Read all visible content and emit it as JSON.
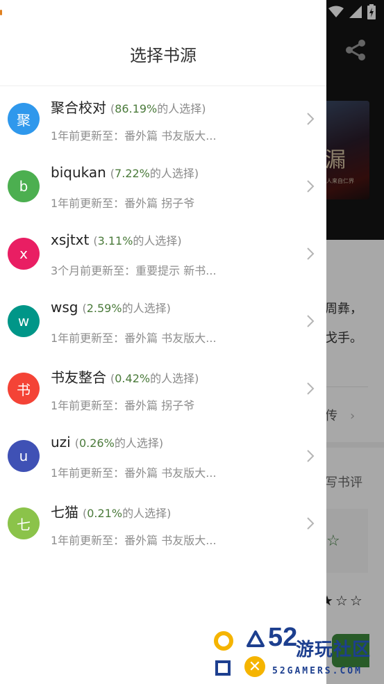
{
  "drawer": {
    "title": "选择书源",
    "sources": [
      {
        "avatar": "聚",
        "avatar_color": "#2f98ec",
        "name": "聚合校对",
        "percent": "86.19%",
        "update": "1年前更新至：番外篇 书友版大..."
      },
      {
        "avatar": "b",
        "avatar_color": "#4caf50",
        "name": "biqukan",
        "percent": "7.22%",
        "update": "1年前更新至：番外篇 拐子爷"
      },
      {
        "avatar": "x",
        "avatar_color": "#e91e63",
        "name": "xsjtxt",
        "percent": "3.11%",
        "update": "3个月前更新至：重要提示 新书..."
      },
      {
        "avatar": "w",
        "avatar_color": "#009688",
        "name": "wsg",
        "percent": "2.59%",
        "update": "1年前更新至：番外篇 书友版大..."
      },
      {
        "avatar": "书",
        "avatar_color": "#f44336",
        "name": "书友整合",
        "percent": "0.42%",
        "update": "1年前更新至：番外篇 拐子爷"
      },
      {
        "avatar": "u",
        "avatar_color": "#3f51b5",
        "name": "uzi",
        "percent": "0.26%",
        "update": "1年前更新至：番外篇 书友版大..."
      },
      {
        "avatar": "七",
        "avatar_color": "#8bc34a",
        "name": "七猫",
        "percent": "0.21%",
        "update": "1年前更新至：番外篇 书友版大..."
      }
    ],
    "percent_suffix": "的人选择)",
    "percent_prefix": "("
  },
  "background": {
    "cover_title": "漏",
    "cover_sub": "人来自仁界",
    "intro_line1": "周彝，",
    "intro_line2": "戈手。",
    "row_label": "传",
    "chevron": "›",
    "write_review": "写书评",
    "review_star": "☆",
    "stars": "★☆☆"
  },
  "watermark": {
    "number": "52",
    "brand": "游玩社区",
    "sub": "52GAMERS.COM",
    "x_glyph": "✕"
  },
  "colors": {
    "percent_green": "#4a7a3a",
    "watermark_blue": "#1d3f8f",
    "watermark_yellow": "#f5b400"
  }
}
